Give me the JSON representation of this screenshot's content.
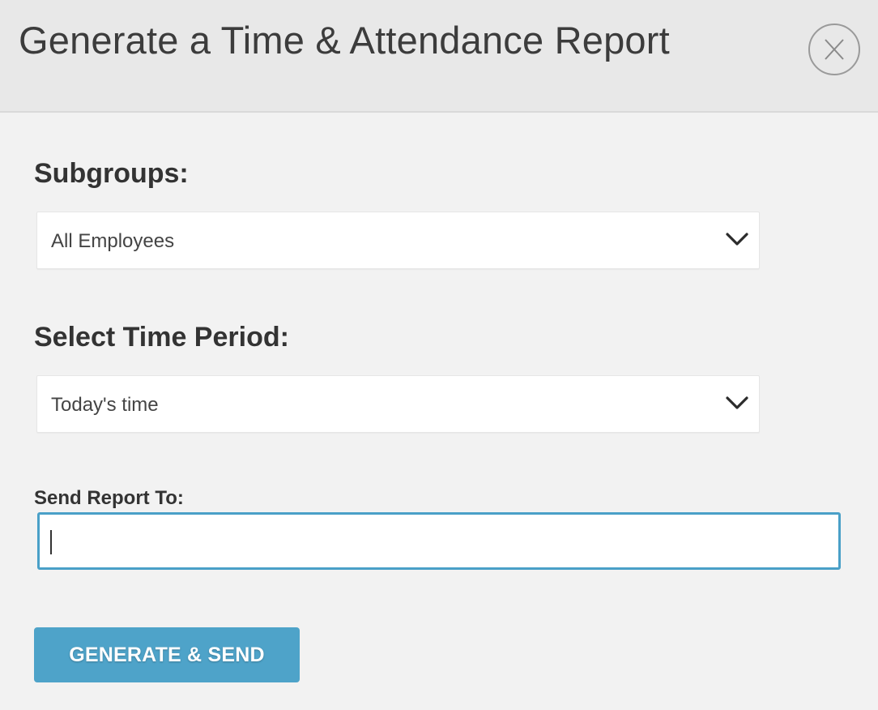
{
  "modal": {
    "title": "Generate a Time & Attendance Report",
    "close_label": "X"
  },
  "subgroups": {
    "label": "Subgroups:",
    "selected": "All Employees"
  },
  "time_period": {
    "label": "Select Time Period:",
    "selected": "Today's time"
  },
  "send_to": {
    "label": "Send Report To:",
    "value": "",
    "placeholder": ""
  },
  "actions": {
    "generate_label": "GENERATE & SEND"
  },
  "colors": {
    "header_bg": "#e8e8e8",
    "body_bg": "#f2f2f2",
    "accent": "#4ea3c9",
    "input_focus_border": "#4aa0c8",
    "text": "#333333"
  },
  "icons": {
    "close": "close-icon",
    "dropdown": "chevron-down-icon"
  }
}
